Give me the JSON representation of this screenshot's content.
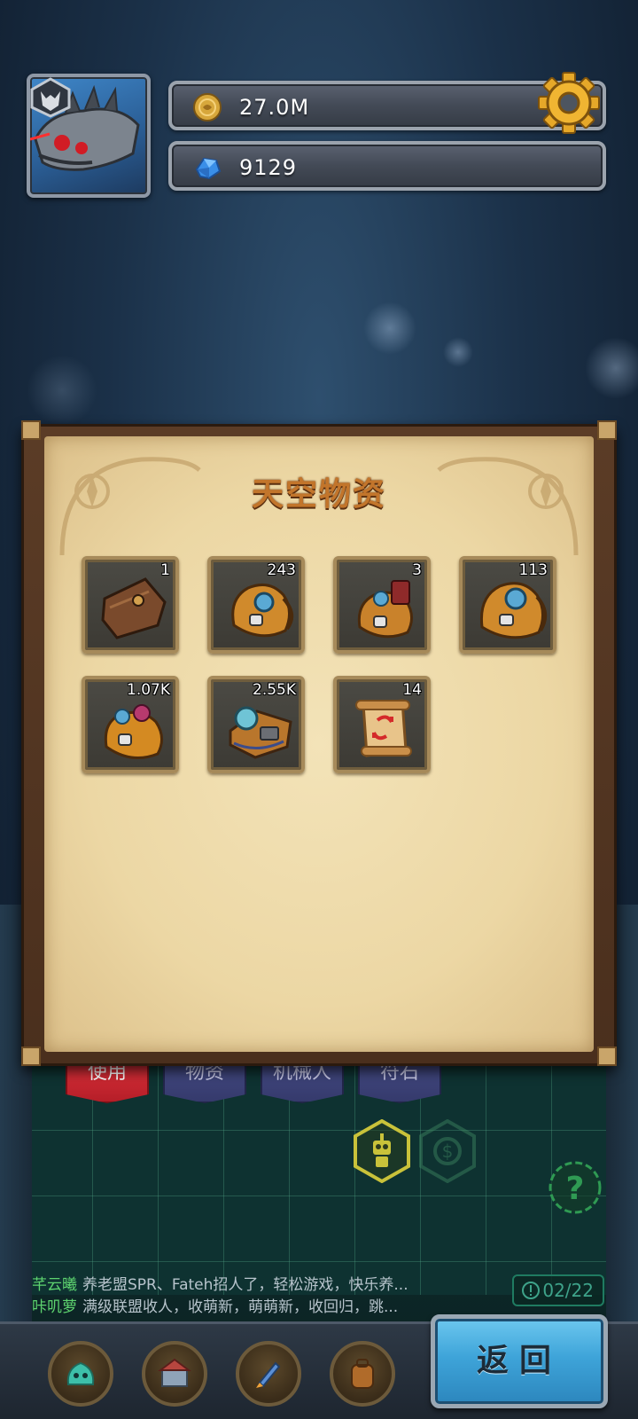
{
  "hud": {
    "coins_value": "27.0M",
    "gems_value": "9129",
    "coin_icon": "coin-icon",
    "gem_icon": "blue-crystal-icon",
    "settings_icon": "gear-icon"
  },
  "panel": {
    "title": "天空物资",
    "items": [
      {
        "icon": "leather-pouch-icon",
        "count": "1"
      },
      {
        "icon": "supply-backpack-icon",
        "count": "243"
      },
      {
        "icon": "gear-backpack-icon",
        "count": "3"
      },
      {
        "icon": "supply-backpack-large-icon",
        "count": "113"
      },
      {
        "icon": "loot-sack-icon",
        "count": "1.07K"
      },
      {
        "icon": "tech-crate-icon",
        "count": "2.55K"
      },
      {
        "icon": "scroll-icon",
        "count": "14"
      }
    ]
  },
  "tabs": [
    {
      "label": "使用",
      "active": true
    },
    {
      "label": "物资",
      "active": false
    },
    {
      "label": "机械人",
      "active": false
    },
    {
      "label": "符石",
      "active": false
    }
  ],
  "chat": {
    "lines": [
      {
        "name": "芊云曦",
        "text": "养老盟SPR、Fateh招人了，轻松游戏，快乐养..."
      },
      {
        "name": "咔叽萝",
        "text": "满级联盟收人，收萌新，萌萌新，收回归，跳..."
      }
    ]
  },
  "counter": {
    "value": "02/22"
  },
  "return_button": {
    "label": "返回"
  },
  "colors": {
    "parchment": "#ecd7a4",
    "title": "#c2752b",
    "active_tab": "#d42a33",
    "inactive_tab": "#3e4379",
    "return_button": "#3ea4d9"
  }
}
